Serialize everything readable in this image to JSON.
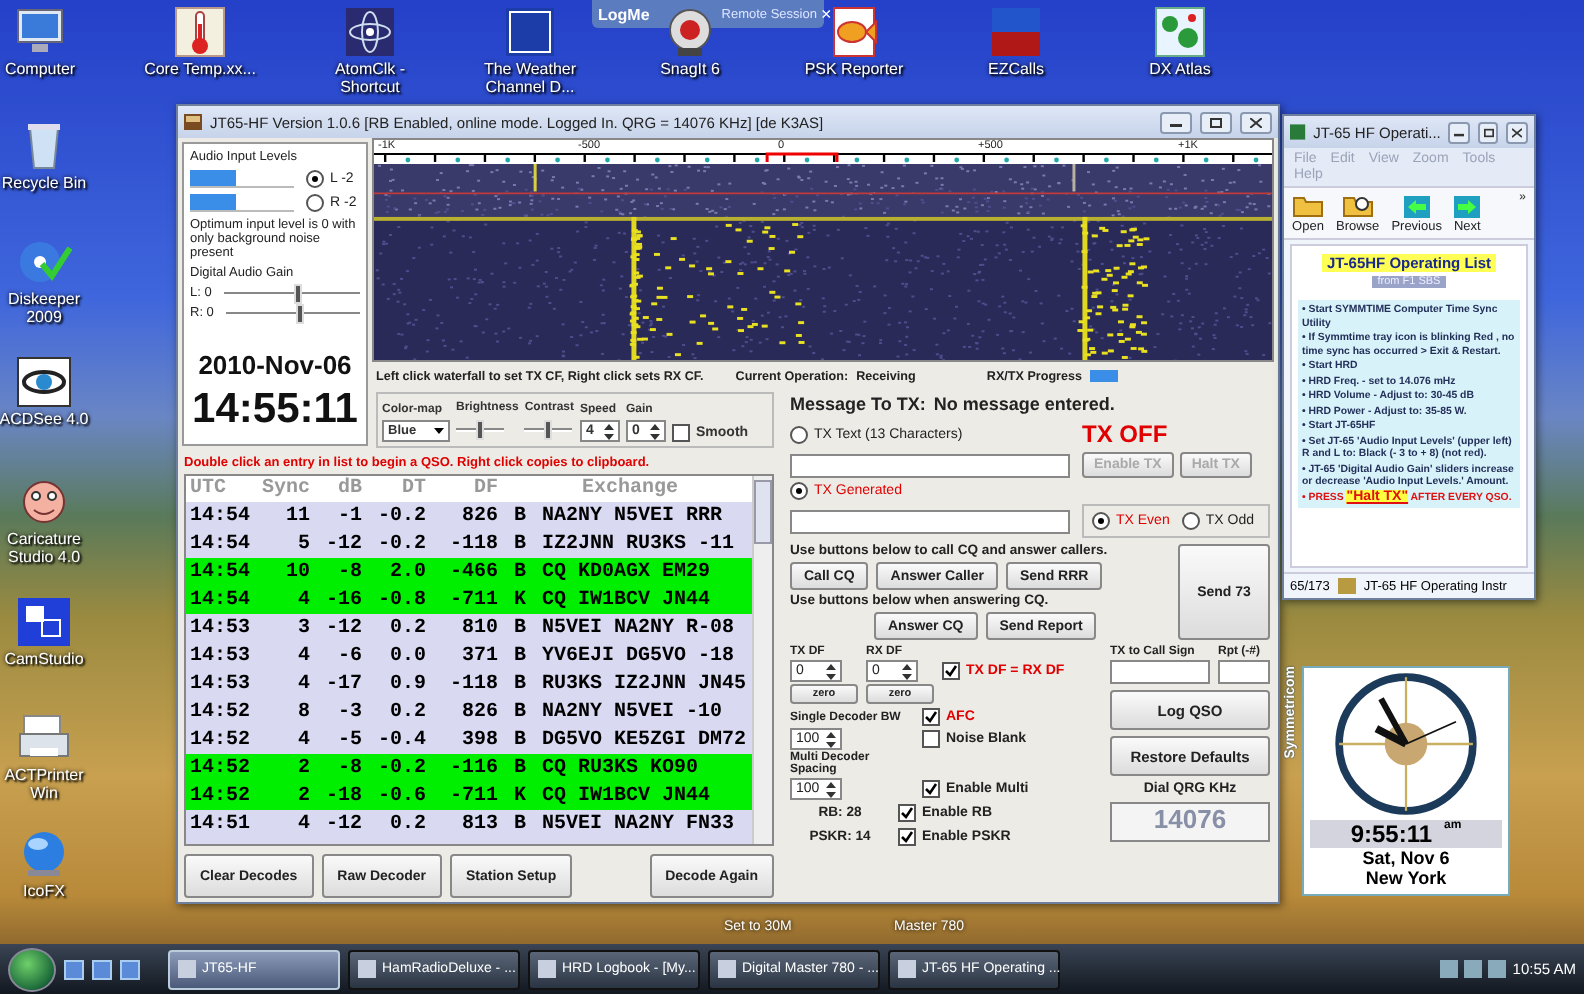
{
  "desktop_top_icons": [
    {
      "label": "Computer"
    },
    {
      "label": "Core Temp.xx..."
    },
    {
      "label": "AtomClk - Shortcut"
    },
    {
      "label": "The Weather Channel D..."
    },
    {
      "label": "SnagIt 6"
    },
    {
      "label": "PSK Reporter"
    },
    {
      "label": "EZCalls"
    },
    {
      "label": "DX Atlas"
    }
  ],
  "desktop_left_icons": [
    {
      "label": "Recycle Bin"
    },
    {
      "label": "Diskeeper 2009"
    },
    {
      "label": "ACDSee 4.0"
    },
    {
      "label": "Caricature Studio 4.0"
    },
    {
      "label": "CamStudio"
    },
    {
      "label": "ACTPrinter Win"
    },
    {
      "label": "IcoFX"
    }
  ],
  "desktop_bottom_labels": [
    "Set to 30M",
    "Master 780"
  ],
  "remote_session_bar": {
    "brand": "LogMe",
    "title": "Remote Session",
    "close": "×"
  },
  "main_window": {
    "title": "JT65-HF Version 1.0.6 [RB Enabled, online mode. Logged In. QRG = 14076 KHz] [de K3AS]",
    "audio": {
      "title": "Audio Input Levels",
      "channels": [
        {
          "label": "L -2",
          "selected": true,
          "level": 0.45
        },
        {
          "label": "R -2",
          "selected": false,
          "level": 0.45
        }
      ],
      "hint": "Optimum input level is 0 with only background noise present",
      "gain_title": "Digital Audio Gain",
      "gain_sliders": [
        {
          "label": "L: 0",
          "level": 0.55
        },
        {
          "label": "R: 0",
          "level": 0.55
        }
      ],
      "date": "2010-Nov-06",
      "time": "14:55:11"
    },
    "waterfall": {
      "scale_labels": [
        "-1K",
        "-500",
        "0",
        "+500",
        "+1K"
      ]
    },
    "status": {
      "hint": "Left click waterfall to set TX CF, Right click sets RX CF.",
      "operation_label": "Current Operation:",
      "operation": "Receiving",
      "progress_label": "RX/TX Progress",
      "progress": {
        "level": 1
      }
    },
    "display": {
      "colormap_label": "Color-map",
      "colormap": "Blue",
      "brightness_label": "Brightness",
      "brightness": {
        "level": 0.5
      },
      "contrast_label": "Contrast",
      "contrast": {
        "level": 0.5
      },
      "speed_label": "Speed",
      "speed": "4",
      "gain_label": "Gain",
      "gain": "0",
      "smooth": {
        "label": "Smooth",
        "checked": false
      }
    },
    "instruction": "Double click an entry in list to begin a QSO. Right click copies to clipboard.",
    "decodes": {
      "columns": [
        "UTC",
        "Sync",
        "dB",
        "DT",
        "DF",
        "Exchange"
      ],
      "rows": [
        {
          "utc": "14:54",
          "sync": "11",
          "db": "-1",
          "dt": "-0.2",
          "df": "826",
          "mode": "B",
          "exchange": "NA2NY N5VEI RRR",
          "highlighted": false
        },
        {
          "utc": "14:54",
          "sync": "5",
          "db": "-12",
          "dt": "-0.2",
          "df": "-118",
          "mode": "B",
          "exchange": "IZ2JNN RU3KS -11",
          "highlighted": false
        },
        {
          "utc": "14:54",
          "sync": "10",
          "db": "-8",
          "dt": "2.0",
          "df": "-466",
          "mode": "B",
          "exchange": "CQ KD0AGX EM29",
          "highlighted": true
        },
        {
          "utc": "14:54",
          "sync": "4",
          "db": "-16",
          "dt": "-0.8",
          "df": "-711",
          "mode": "K",
          "exchange": "CQ IW1BCV JN44",
          "highlighted": true
        },
        {
          "utc": "14:53",
          "sync": "3",
          "db": "-12",
          "dt": "0.2",
          "df": "810",
          "mode": "B",
          "exchange": "N5VEI NA2NY R-08",
          "highlighted": false
        },
        {
          "utc": "14:53",
          "sync": "4",
          "db": "-6",
          "dt": "0.0",
          "df": "371",
          "mode": "B",
          "exchange": "YV6EJI DG5VO -18",
          "highlighted": false
        },
        {
          "utc": "14:53",
          "sync": "4",
          "db": "-17",
          "dt": "0.9",
          "df": "-118",
          "mode": "B",
          "exchange": "RU3KS IZ2JNN JN45",
          "highlighted": false
        },
        {
          "utc": "14:52",
          "sync": "8",
          "db": "-3",
          "dt": "0.2",
          "df": "826",
          "mode": "B",
          "exchange": "NA2NY N5VEI -10",
          "highlighted": false
        },
        {
          "utc": "14:52",
          "sync": "4",
          "db": "-5",
          "dt": "-0.4",
          "df": "398",
          "mode": "B",
          "exchange": "DG5VO KE5ZGI DM72",
          "highlighted": false
        },
        {
          "utc": "14:52",
          "sync": "2",
          "db": "-8",
          "dt": "-0.2",
          "df": "-116",
          "mode": "B",
          "exchange": "CQ RU3KS KO90",
          "highlighted": true
        },
        {
          "utc": "14:52",
          "sync": "2",
          "db": "-18",
          "dt": "-0.6",
          "df": "-711",
          "mode": "K",
          "exchange": "CQ IW1BCV JN44",
          "highlighted": true
        },
        {
          "utc": "14:51",
          "sync": "4",
          "db": "-12",
          "dt": "0.2",
          "df": "813",
          "mode": "B",
          "exchange": "N5VEI NA2NY FN33",
          "highlighted": false
        }
      ]
    },
    "bottom_buttons": [
      "Clear Decodes",
      "Raw Decoder",
      "Station Setup",
      "Decode Again"
    ],
    "tx": {
      "message_label": "Message To TX:",
      "message": "No message entered.",
      "status": "TX OFF",
      "modes": [
        {
          "label": "TX Text (13 Characters)",
          "selected": false
        },
        {
          "label": "TX Generated",
          "selected": true
        }
      ],
      "enable_button": {
        "label": "Enable TX",
        "disabled": true
      },
      "halt_button": {
        "label": "Halt TX",
        "disabled": true
      },
      "period": [
        {
          "label": "TX Even",
          "selected": true
        },
        {
          "label": "TX Odd",
          "selected": false
        }
      ],
      "cq_hint": "Use buttons below to call CQ and answer callers.",
      "cq_buttons": [
        "Call CQ",
        "Answer Caller",
        "Send RRR"
      ],
      "answer_hint": "Use buttons below when answering CQ.",
      "answer_buttons": [
        "Answer CQ",
        "Send Report"
      ],
      "send73": "Send 73",
      "tx_df": {
        "label": "TX DF",
        "value": "0",
        "zero": "zero"
      },
      "rx_df": {
        "label": "RX DF",
        "value": "0",
        "zero": "zero"
      },
      "lock_df": {
        "label": "TX DF = RX DF",
        "checked": true
      },
      "call_sign_label": "TX to Call Sign",
      "report_label": "Rpt (-#)",
      "single_bw": {
        "label": "Single Decoder BW",
        "value": "100"
      },
      "afc": {
        "label": "AFC",
        "checked": true
      },
      "noise_blank": {
        "label": "Noise Blank",
        "checked": false
      },
      "multi_spacing": {
        "label": "Multi Decoder Spacing",
        "value": "100"
      },
      "enable_multi": {
        "label": "Enable Multi",
        "checked": true
      },
      "log_qso": "Log QSO",
      "restore": "Restore Defaults",
      "dial_label": "Dial QRG KHz",
      "dial": "14076",
      "rb": "RB: 28",
      "pskr": "PSKR: 14",
      "enable_rb": {
        "label": "Enable RB",
        "checked": true
      },
      "enable_pskr": {
        "label": "Enable PSKR",
        "checked": true
      }
    }
  },
  "ops_window": {
    "title": "JT-65 HF Operati...",
    "menu": [
      "File",
      "Edit",
      "View",
      "Zoom",
      "Tools",
      "Help"
    ],
    "toolbar": [
      "Open",
      "Browse",
      "Previous",
      "Next"
    ],
    "more": "»",
    "heading": "JT-65HF Operating List",
    "subheading": "from F1 SBS",
    "items": [
      {
        "kind": "step",
        "text": "• Start SYMMTIME Computer Time Sync Utility"
      },
      {
        "kind": "step",
        "text": "• If Symmtime tray icon is blinking Red , no time sync has occurred > Exit & Restart."
      },
      {
        "kind": "step",
        "text": "• Start HRD"
      },
      {
        "kind": "step",
        "text": "• HRD Freq. - set to 14.076 mHz"
      },
      {
        "kind": "step",
        "text": "• HRD Volume - Adjust to: 30-45 dB"
      },
      {
        "kind": "step",
        "text": "• HRD Power - Adjust to: 35-85 W."
      },
      {
        "kind": "step",
        "text": "• Start JT-65HF"
      },
      {
        "kind": "step",
        "text": "• Set JT-65 'Audio Input Levels' (upper left) R and L to: Black (- 3 to + 8) (not red)."
      },
      {
        "kind": "step",
        "text": "• JT-65 'Digital Audio Gain' sliders increase or decrease 'Audio Input Levels.' Amount."
      },
      {
        "kind": "warning",
        "text": "• PRESS **\"Halt TX\"** AFTER EVERY QSO."
      }
    ],
    "status": [
      "65/173",
      "JT-65 HF Operating Instr"
    ]
  },
  "clock_widget": {
    "brand": "Symmetricom",
    "time": "9:55:11",
    "ampm": "am",
    "date": "Sat, Nov 6",
    "city": "New York"
  },
  "taskbar": {
    "tasks": [
      {
        "label": "JT65-HF",
        "selected": true
      },
      {
        "label": "HamRadioDeluxe - ...",
        "selected": false
      },
      {
        "label": "HRD Logbook - [My...",
        "selected": false
      },
      {
        "label": "Digital Master 780 - ...",
        "selected": false
      },
      {
        "label": "JT-65 HF Operating ...",
        "selected": false
      }
    ],
    "clock": "10:55 AM"
  }
}
